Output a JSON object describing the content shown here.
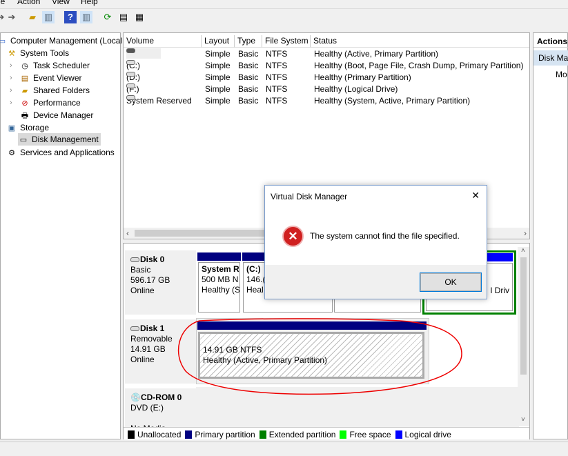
{
  "menu": [
    "le",
    "Action",
    "View",
    "Help"
  ],
  "tree": {
    "root": "Computer Management (Local",
    "items": [
      "System Tools",
      "Task Scheduler",
      "Event Viewer",
      "Shared Folders",
      "Performance",
      "Device Manager",
      "Storage",
      "Disk Management",
      "Services and Applications"
    ]
  },
  "volumes": {
    "headers": [
      "Volume",
      "Layout",
      "Type",
      "File System",
      "Status"
    ],
    "rows": [
      [
        "",
        "Simple",
        "Basic",
        "NTFS",
        "Healthy (Active, Primary Partition)"
      ],
      [
        "(C:)",
        "Simple",
        "Basic",
        "NTFS",
        "Healthy (Boot, Page File, Crash Dump, Primary Partition)"
      ],
      [
        "(D:)",
        "Simple",
        "Basic",
        "NTFS",
        "Healthy (Primary Partition)"
      ],
      [
        "(F:)",
        "Simple",
        "Basic",
        "NTFS",
        "Healthy (Logical Drive)"
      ],
      [
        "System Reserved",
        "Simple",
        "Basic",
        "NTFS",
        "Healthy (System, Active, Primary Partition)"
      ]
    ]
  },
  "disks": [
    {
      "name": "Disk 0",
      "type": "Basic",
      "size": "596.17 GB",
      "status": "Online",
      "parts": [
        {
          "name": "System R",
          "size": "500 MB N",
          "status": "Healthy (S"
        },
        {
          "name": "(C:)",
          "size": "146.(",
          "status": "Heal"
        },
        {
          "name": "",
          "size": "",
          "status": "l Driv"
        }
      ]
    },
    {
      "name": "Disk 1",
      "type": "Removable",
      "size": "14.91 GB",
      "status": "Online",
      "parts": [
        {
          "size": "14.91 GB NTFS",
          "status": "Healthy (Active, Primary Partition)"
        }
      ]
    },
    {
      "name": "CD-ROM 0",
      "type": "DVD (E:)",
      "status": "No Media"
    }
  ],
  "legend": [
    {
      "label": "Unallocated",
      "color": "#000000"
    },
    {
      "label": "Primary partition",
      "color": "#000080"
    },
    {
      "label": "Extended partition",
      "color": "#008000"
    },
    {
      "label": "Free space",
      "color": "#00ff00"
    },
    {
      "label": "Logical drive",
      "color": "#0000ff"
    }
  ],
  "actions": {
    "title": "Actions",
    "item": "Disk Ma",
    "sub": "Mo"
  },
  "dialog": {
    "title": "Virtual Disk Manager",
    "message": "The system cannot find the file specified.",
    "ok": "OK",
    "close": "✕"
  }
}
